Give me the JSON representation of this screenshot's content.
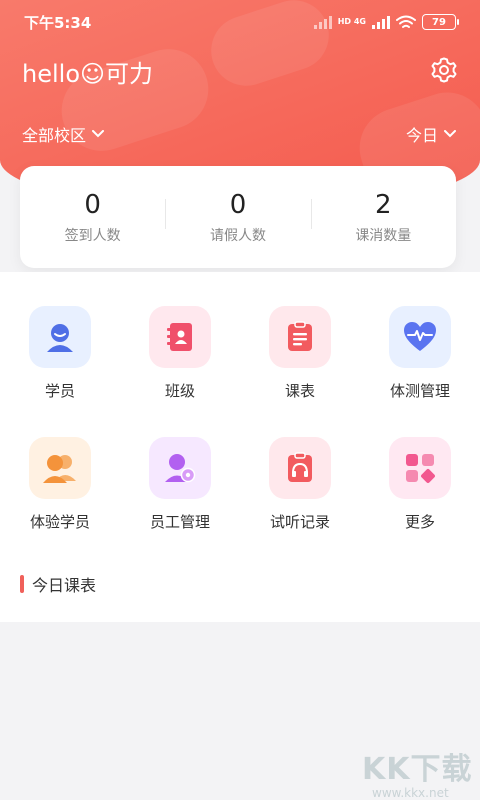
{
  "status_bar": {
    "time": "下午5:34",
    "network": "HD 4G",
    "battery": "79"
  },
  "header": {
    "greeting": "hello☺可力",
    "campus": "全部校区",
    "date_filter": "今日"
  },
  "stats": [
    {
      "value": "0",
      "label": "签到人数"
    },
    {
      "value": "0",
      "label": "请假人数"
    },
    {
      "value": "2",
      "label": "课消数量"
    }
  ],
  "grid": [
    {
      "label": "学员",
      "icon": "student-icon",
      "bg": "#e8f0ff",
      "color": "#4f6fe6"
    },
    {
      "label": "班级",
      "icon": "class-book-icon",
      "bg": "#ffe8ee",
      "color": "#f0506b"
    },
    {
      "label": "课表",
      "icon": "schedule-icon",
      "bg": "#ffe8ec",
      "color": "#f25b5f"
    },
    {
      "label": "体测管理",
      "icon": "heart-pulse-icon",
      "bg": "#e8f0ff",
      "color": "#5a74f0"
    },
    {
      "label": "体验学员",
      "icon": "trial-students-icon",
      "bg": "#fff1e2",
      "color": "#f4933b"
    },
    {
      "label": "员工管理",
      "icon": "staff-gear-icon",
      "bg": "#f6e8ff",
      "color": "#b260f0"
    },
    {
      "label": "试听记录",
      "icon": "audition-record-icon",
      "bg": "#ffe8ec",
      "color": "#f25b5f"
    },
    {
      "label": "更多",
      "icon": "more-grid-icon",
      "bg": "#ffe8f2",
      "color": "#f2588f"
    }
  ],
  "today_section": {
    "title": "今日课表"
  },
  "watermark": {
    "logo": "KK下载",
    "url": "www.kkx.net"
  },
  "colors": {
    "header": "#f45a4d",
    "accent": "#f0605a"
  }
}
